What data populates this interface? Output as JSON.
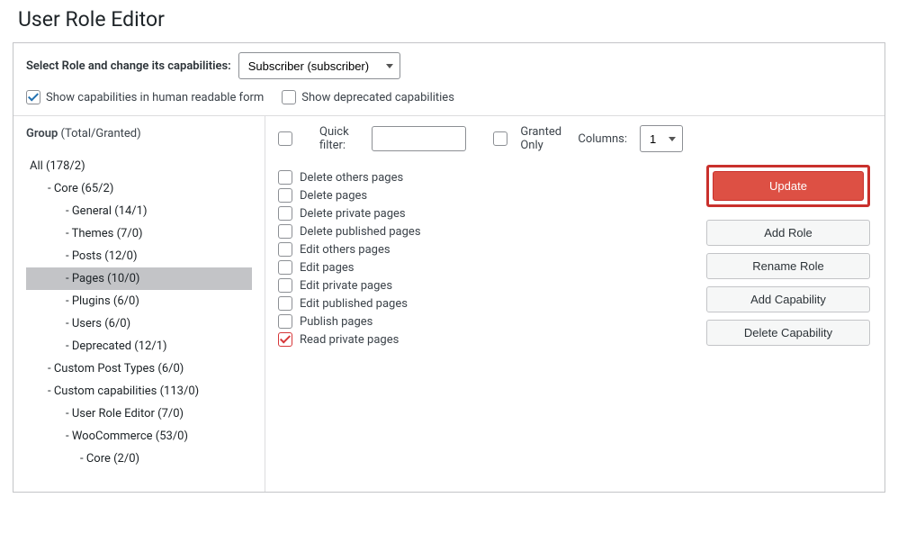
{
  "title": "User Role Editor",
  "selector": {
    "label": "Select Role and change its capabilities:",
    "value": "Subscriber (subscriber)"
  },
  "opts": {
    "human_readable": "Show capabilities in human readable form",
    "human_readable_checked": true,
    "deprecated": "Show deprecated capabilities",
    "deprecated_checked": false
  },
  "group": {
    "header_label": "Group",
    "header_suffix": "(Total/Granted)",
    "items": [
      {
        "label": "All (178/2)",
        "level": 0,
        "selected": false
      },
      {
        "label": "- Core (65/2)",
        "level": 1,
        "selected": false
      },
      {
        "label": "- General (14/1)",
        "level": 2,
        "selected": false
      },
      {
        "label": "- Themes (7/0)",
        "level": 2,
        "selected": false
      },
      {
        "label": "- Posts (12/0)",
        "level": 2,
        "selected": false
      },
      {
        "label": "- Pages (10/0)",
        "level": 2,
        "selected": true
      },
      {
        "label": "- Plugins (6/0)",
        "level": 2,
        "selected": false
      },
      {
        "label": "- Users (6/0)",
        "level": 2,
        "selected": false
      },
      {
        "label": "- Deprecated (12/1)",
        "level": 2,
        "selected": false
      },
      {
        "label": "- Custom Post Types (6/0)",
        "level": 1,
        "selected": false
      },
      {
        "label": "- Custom capabilities (113/0)",
        "level": 1,
        "selected": false
      },
      {
        "label": "- User Role Editor (7/0)",
        "level": 2,
        "selected": false
      },
      {
        "label": "- WooCommerce (53/0)",
        "level": 2,
        "selected": false
      },
      {
        "label": "- Core (2/0)",
        "level": 3,
        "selected": false
      }
    ]
  },
  "filter": {
    "quick_label": "Quick filter:",
    "granted_label": "Granted Only",
    "columns_label": "Columns:",
    "columns_value": "1"
  },
  "caps": [
    {
      "label": "Delete others pages",
      "checked": false
    },
    {
      "label": "Delete pages",
      "checked": false
    },
    {
      "label": "Delete private pages",
      "checked": false
    },
    {
      "label": "Delete published pages",
      "checked": false
    },
    {
      "label": "Edit others pages",
      "checked": false
    },
    {
      "label": "Edit pages",
      "checked": false
    },
    {
      "label": "Edit private pages",
      "checked": false
    },
    {
      "label": "Edit published pages",
      "checked": false
    },
    {
      "label": "Publish pages",
      "checked": false
    },
    {
      "label": "Read private pages",
      "checked": true
    }
  ],
  "actions": {
    "update": "Update",
    "add_role": "Add Role",
    "rename_role": "Rename Role",
    "add_cap": "Add Capability",
    "delete_cap": "Delete Capability"
  }
}
